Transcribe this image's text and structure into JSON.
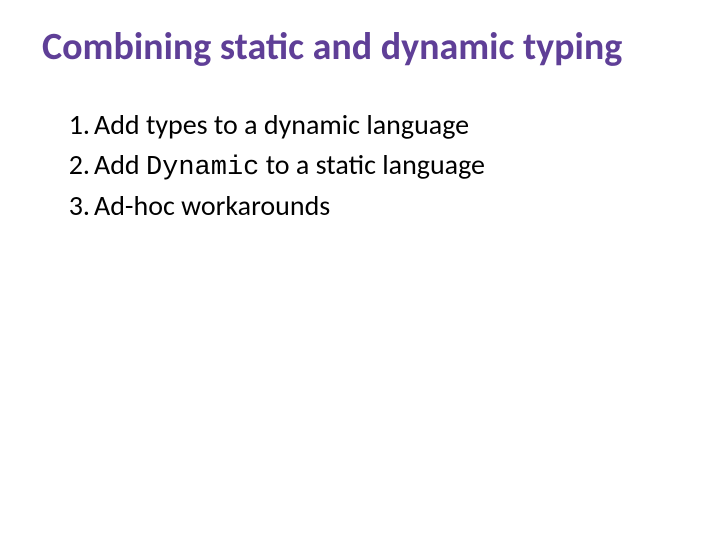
{
  "title": "Combining static and dynamic typing",
  "items": [
    {
      "pre": "Add types to a dynamic language",
      "code": "",
      "post": ""
    },
    {
      "pre": "Add ",
      "code": "Dynamic",
      "post": " to a static language"
    },
    {
      "pre": "Ad-hoc workarounds",
      "code": "",
      "post": ""
    }
  ]
}
